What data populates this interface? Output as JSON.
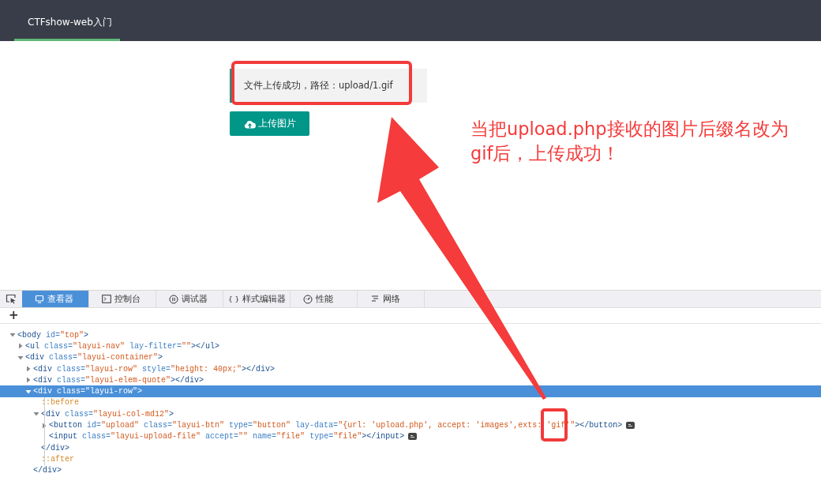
{
  "nav": {
    "tabs": [
      {
        "label": "CTFshow-web入门",
        "selected": true
      }
    ]
  },
  "quote": {
    "text": "文件上传成功，路径：upload/1.gif"
  },
  "upload_button": {
    "label": "上传图片"
  },
  "annotation": {
    "note": "当把upload.php接收的图片后缀名改为gif后，上传成功！"
  },
  "devtools": {
    "tabs": [
      {
        "kind": "inspector",
        "label": "查看器",
        "selected": true
      },
      {
        "kind": "console",
        "label": "控制台",
        "selected": false
      },
      {
        "kind": "debugger",
        "label": "调试器",
        "selected": false
      },
      {
        "kind": "style-editor",
        "glyph": "{ }",
        "label": "样式编辑器",
        "selected": false
      },
      {
        "kind": "performance",
        "label": "性能",
        "selected": false
      },
      {
        "kind": "network",
        "label": "网络",
        "selected": false
      }
    ],
    "add_button": "+",
    "tree": [
      {
        "kind": "element",
        "expanded": true,
        "selected": false,
        "event": false,
        "parts": [
          {
            "kind": "tag",
            "text": "<body"
          },
          {
            "kind": "attr",
            "text": " id="
          },
          {
            "kind": "value",
            "text": "\"top\""
          },
          {
            "kind": "tag",
            "text": ">"
          }
        ],
        "children": [
          {
            "kind": "element",
            "expanded": false,
            "selected": false,
            "event": false,
            "parts": [
              {
                "kind": "tag",
                "text": "<ul"
              },
              {
                "kind": "attr",
                "text": " class="
              },
              {
                "kind": "value",
                "text": "\"layui-nav\""
              },
              {
                "kind": "attr",
                "text": " lay-filter="
              },
              {
                "kind": "value",
                "text": "\"\""
              },
              {
                "kind": "tag",
                "text": "></ul>"
              }
            ]
          },
          {
            "kind": "element",
            "expanded": true,
            "selected": false,
            "event": false,
            "parts": [
              {
                "kind": "tag",
                "text": "<div"
              },
              {
                "kind": "attr",
                "text": " class="
              },
              {
                "kind": "value",
                "text": "\"layui-container\""
              },
              {
                "kind": "tag",
                "text": ">"
              }
            ],
            "children": [
              {
                "kind": "element",
                "expanded": false,
                "selected": false,
                "event": false,
                "parts": [
                  {
                    "kind": "tag",
                    "text": "<div"
                  },
                  {
                    "kind": "attr",
                    "text": " class="
                  },
                  {
                    "kind": "value",
                    "text": "\"layui-row\""
                  },
                  {
                    "kind": "attr",
                    "text": " style="
                  },
                  {
                    "kind": "value",
                    "text": "\"height: 40px;\""
                  },
                  {
                    "kind": "tag",
                    "text": "></div>"
                  }
                ]
              },
              {
                "kind": "element",
                "expanded": false,
                "selected": false,
                "event": false,
                "parts": [
                  {
                    "kind": "tag",
                    "text": "<div"
                  },
                  {
                    "kind": "attr",
                    "text": " class="
                  },
                  {
                    "kind": "value",
                    "text": "\"layui-elem-quote\""
                  },
                  {
                    "kind": "tag",
                    "text": "></div>"
                  }
                ]
              },
              {
                "kind": "element",
                "expanded": true,
                "selected": true,
                "event": false,
                "parts": [
                  {
                    "kind": "tag",
                    "text": "<div"
                  },
                  {
                    "kind": "attr",
                    "text": " class="
                  },
                  {
                    "kind": "value",
                    "text": "\"layui-row\""
                  },
                  {
                    "kind": "tag",
                    "text": ">"
                  }
                ],
                "children": [
                  {
                    "kind": "pseudo",
                    "selected": false,
                    "parts": [
                      {
                        "kind": "pseudo",
                        "text": "::before"
                      }
                    ]
                  },
                  {
                    "kind": "element",
                    "expanded": true,
                    "selected": false,
                    "event": false,
                    "parts": [
                      {
                        "kind": "tag",
                        "text": "<div"
                      },
                      {
                        "kind": "attr",
                        "text": " class="
                      },
                      {
                        "kind": "value",
                        "text": "\"layui-col-md12\""
                      },
                      {
                        "kind": "tag",
                        "text": ">"
                      }
                    ],
                    "children": [
                      {
                        "kind": "element",
                        "expanded": false,
                        "selected": false,
                        "event": true,
                        "parts": [
                          {
                            "kind": "tag",
                            "text": "<button"
                          },
                          {
                            "kind": "attr",
                            "text": " id="
                          },
                          {
                            "kind": "value",
                            "text": "\"upload\""
                          },
                          {
                            "kind": "attr",
                            "text": " class="
                          },
                          {
                            "kind": "value",
                            "text": "\"layui-btn\""
                          },
                          {
                            "kind": "attr",
                            "text": " type="
                          },
                          {
                            "kind": "value",
                            "text": "\"button\""
                          },
                          {
                            "kind": "attr",
                            "text": " lay-data="
                          },
                          {
                            "kind": "value",
                            "text": "\"{url: 'upload.php', accept: 'images',exts: 'gif'\""
                          },
                          {
                            "kind": "tag",
                            "text": "></button>"
                          }
                        ]
                      },
                      {
                        "kind": "leaf",
                        "selected": false,
                        "event": true,
                        "parts": [
                          {
                            "kind": "tag",
                            "text": "<input"
                          },
                          {
                            "kind": "attr",
                            "text": " class="
                          },
                          {
                            "kind": "value",
                            "text": "\"layui-upload-file\""
                          },
                          {
                            "kind": "attr",
                            "text": " accept="
                          },
                          {
                            "kind": "value",
                            "text": "\"\""
                          },
                          {
                            "kind": "attr",
                            "text": " name="
                          },
                          {
                            "kind": "value",
                            "text": "\"file\""
                          },
                          {
                            "kind": "attr",
                            "text": " type="
                          },
                          {
                            "kind": "value",
                            "text": "\"file\""
                          },
                          {
                            "kind": "tag",
                            "text": "></input>"
                          }
                        ]
                      }
                    ]
                  },
                  {
                    "kind": "close",
                    "selected": false,
                    "parts": [
                      {
                        "kind": "tag",
                        "text": "</div>"
                      }
                    ]
                  },
                  {
                    "kind": "pseudo",
                    "selected": false,
                    "parts": [
                      {
                        "kind": "pseudo",
                        "text": "::after"
                      }
                    ]
                  }
                ]
              },
              {
                "kind": "close",
                "selected": false,
                "parts": [
                  {
                    "kind": "tag",
                    "text": "</div>"
                  }
                ]
              }
            ]
          }
        ]
      }
    ]
  }
}
